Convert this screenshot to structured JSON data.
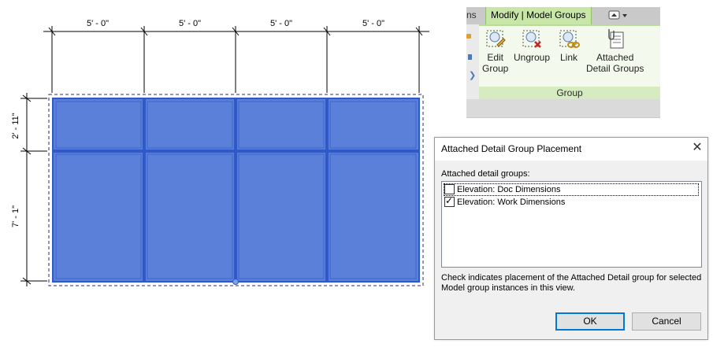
{
  "drawing": {
    "top_dimensions": [
      "5' - 0\"",
      "5' - 0\"",
      "5' - 0\"",
      "5' - 0\""
    ],
    "left_dimensions": [
      "2' - 11\"",
      "7' - 1\""
    ],
    "colors": {
      "panel_fill": "#5b80d9",
      "frame": "#2f59c9"
    }
  },
  "ribbon": {
    "prev_tab_fragment": "ns",
    "active_tab": "Modify | Model Groups",
    "buttons": {
      "edit_group": [
        "Edit",
        "Group"
      ],
      "ungroup": "Ungroup",
      "link": "Link",
      "attached_detail_groups": [
        "Attached",
        "Detail Groups"
      ]
    },
    "panel_title": "Group",
    "accent": "#c8e6a8"
  },
  "dialog": {
    "title": "Attached Detail Group Placement",
    "list_label": "Attached detail groups:",
    "items": [
      {
        "label": "Elevation: Doc Dimensions",
        "checked": false
      },
      {
        "label": "Elevation: Work Dimensions",
        "checked": true
      }
    ],
    "help_text": "Check indicates placement of the Attached Detail group for selected Model group instances in this view.",
    "ok_label": "OK",
    "cancel_label": "Cancel",
    "close_symbol": "✕"
  }
}
